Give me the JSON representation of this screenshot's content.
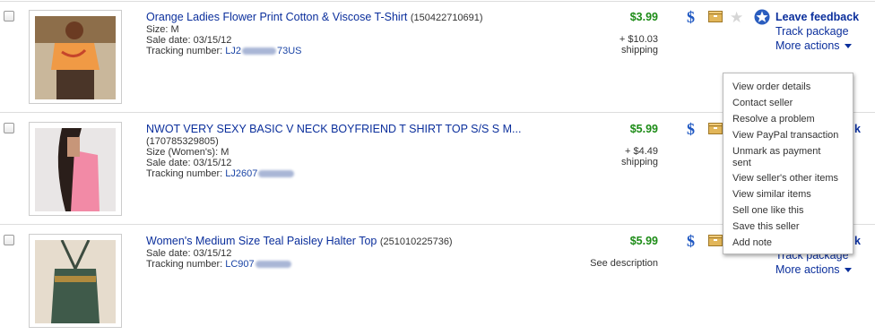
{
  "items": [
    {
      "title": "Orange Ladies Flower Print Cotton & Viscose T-Shirt",
      "item_id": "(150422710691)",
      "details": [
        "Size: M",
        "Sale date: 03/15/12"
      ],
      "tracking_label": "Tracking number:",
      "tracking_prefix": "LJ2",
      "tracking_suffix": "73US",
      "price": "$3.99",
      "shipping_line1": "+ $10.03",
      "shipping_line2": "shipping"
    },
    {
      "title": "NWOT VERY SEXY BASIC V NECK BOYFRIEND T SHIRT TOP S/S S M...",
      "item_id": "(170785329805)",
      "details": [
        "Size (Women's): M",
        "Sale date: 03/15/12"
      ],
      "tracking_label": "Tracking number:",
      "tracking_prefix": "LJ2607",
      "tracking_suffix": "",
      "price": "$5.99",
      "shipping_line1": "+ $4.49",
      "shipping_line2": "shipping"
    },
    {
      "title": "Women's Medium Size Teal Paisley Halter Top",
      "item_id": "(251010225736)",
      "details": [
        "Sale date: 03/15/12"
      ],
      "tracking_label": "Tracking number:",
      "tracking_prefix": "LC907",
      "tracking_suffix": "",
      "price": "$5.99",
      "shipping_line1": "See description",
      "shipping_line2": ""
    }
  ],
  "actions": {
    "leave_feedback": "Leave feedback",
    "track_package": "Track package",
    "more_actions": "More actions"
  },
  "row2_partial_action": "k",
  "more_actions_menu": [
    "View order details",
    "Contact seller",
    "Resolve a problem",
    "View PayPal transaction",
    "Unmark as payment sent",
    "View seller's other items",
    "View similar items",
    "Sell one like this",
    "Save this seller",
    "Add note"
  ],
  "icons": [
    "dollar-icon",
    "package-icon",
    "star-outline-icon",
    "feedback-star-icon"
  ],
  "colors": {
    "link": "#0b2f9c",
    "price": "#1d8c17",
    "dollar": "#1e57c2"
  }
}
